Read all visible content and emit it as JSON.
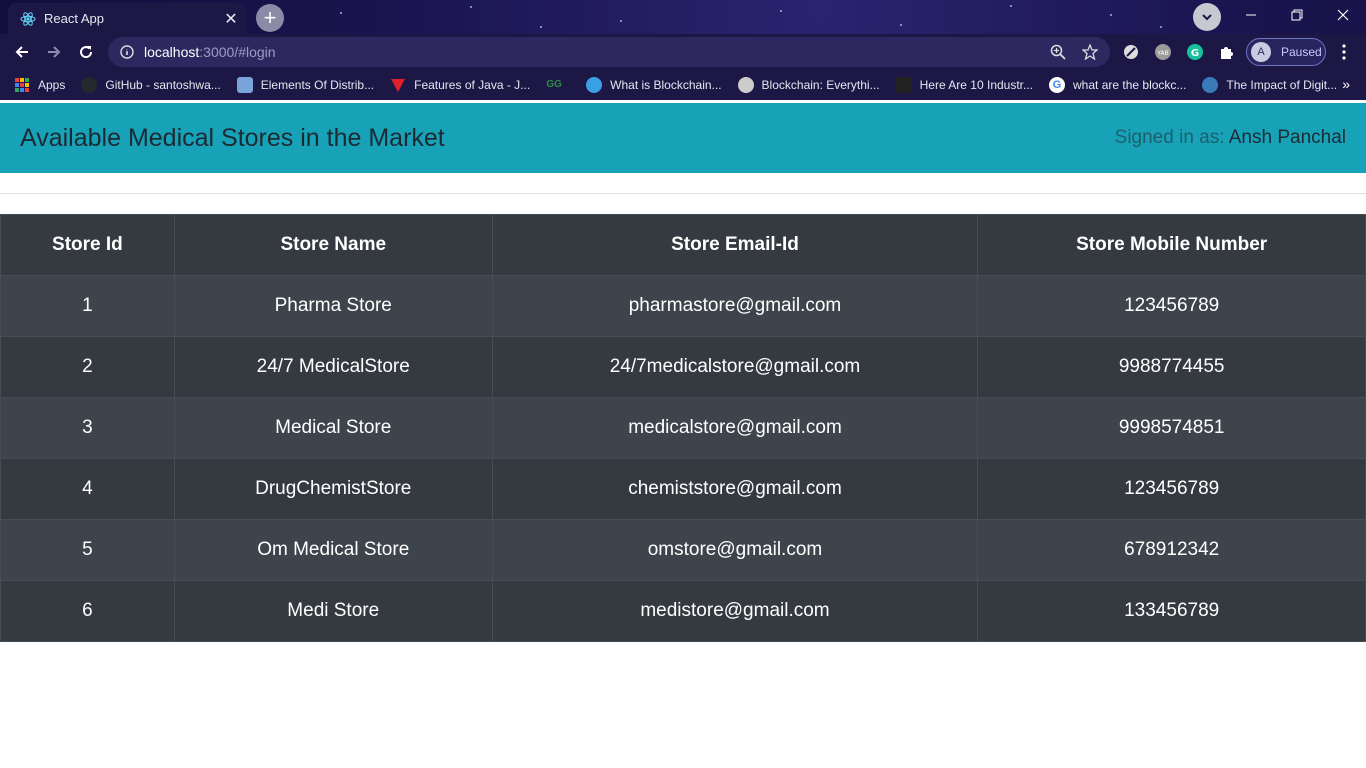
{
  "browser": {
    "tab_title": "React App",
    "url_host": "localhost",
    "url_rest": ":3000/#login",
    "profile_initial": "A",
    "profile_status": "Paused",
    "apps_label": "Apps",
    "bookmarks": [
      {
        "label": "GitHub - santoshwa...",
        "icon": "github-icon",
        "color": "#24292e"
      },
      {
        "label": "Elements Of Distrib...",
        "icon": "book-icon",
        "color": "#7aa3d9"
      },
      {
        "label": "Features of Java - J...",
        "icon": "javatpoint-icon",
        "color": "#e0202a"
      },
      {
        "label": "",
        "icon": "geeksforgeeks-icon",
        "color": "#2f8d46"
      },
      {
        "label": "What is Blockchain...",
        "icon": "globe-icon",
        "color": "#3aa0e6"
      },
      {
        "label": "Blockchain: Everythi...",
        "icon": "blockchain-icon",
        "color": "#cccccc"
      },
      {
        "label": "Here Are 10 Industr...",
        "icon": "page-icon",
        "color": "#222222"
      },
      {
        "label": "what are the blockc...",
        "icon": "google-icon",
        "color": "#ffffff"
      },
      {
        "label": "The Impact of Digit...",
        "icon": "site-icon",
        "color": "#3b7ab8"
      }
    ]
  },
  "app": {
    "title": "Available Medical Stores in the Market",
    "signed_in_prefix": "Signed in as: ",
    "signed_in_user": "Ansh Panchal"
  },
  "table": {
    "headers": [
      "Store Id",
      "Store Name",
      "Store Email-Id",
      "Store Mobile Number"
    ],
    "rows": [
      [
        "1",
        "Pharma Store",
        "pharmastore@gmail.com",
        "123456789"
      ],
      [
        "2",
        "24/7 MedicalStore",
        "24/7medicalstore@gmail.com",
        "9988774455"
      ],
      [
        "3",
        "Medical Store",
        "medicalstore@gmail.com",
        "9998574851"
      ],
      [
        "4",
        "DrugChemistStore",
        "chemiststore@gmail.com",
        "123456789"
      ],
      [
        "5",
        "Om Medical Store",
        "omstore@gmail.com",
        "678912342"
      ],
      [
        "6",
        "Medi Store",
        "medistore@gmail.com",
        "133456789"
      ]
    ]
  },
  "colors": {
    "header_bar": "#17a2b8",
    "table_dark": "#343a40",
    "table_stripe": "#3e444b"
  }
}
